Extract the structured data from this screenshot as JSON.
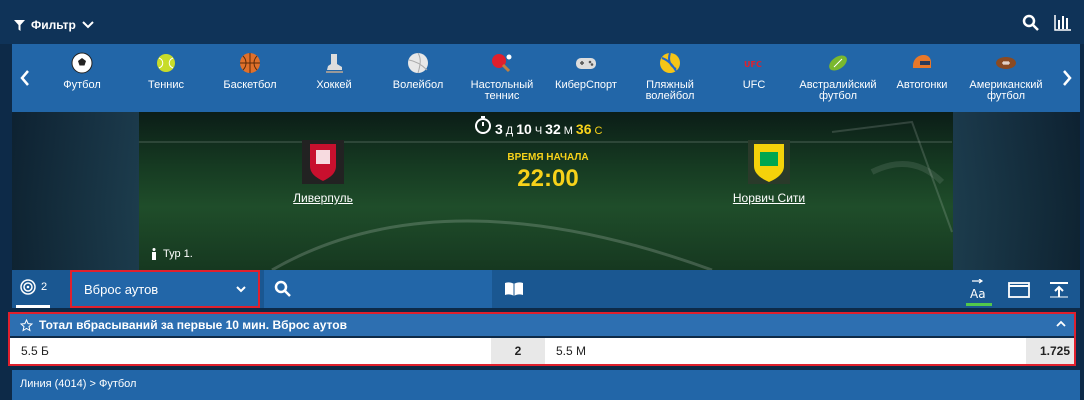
{
  "topbar": {
    "filter_label": "Фильтр"
  },
  "sports": [
    {
      "label": "Футбол",
      "icon": "soccer-ball-icon"
    },
    {
      "label": "Теннис",
      "icon": "tennis-ball-icon"
    },
    {
      "label": "Баскетбол",
      "icon": "basketball-icon"
    },
    {
      "label": "Хоккей",
      "icon": "hockey-skate-icon"
    },
    {
      "label": "Волейбол",
      "icon": "volleyball-icon"
    },
    {
      "label": "Настольный теннис",
      "icon": "ping-pong-icon"
    },
    {
      "label": "КиберСпорт",
      "icon": "gamepad-icon"
    },
    {
      "label": "Пляжный волейбол",
      "icon": "beach-volleyball-icon"
    },
    {
      "label": "UFC",
      "icon": "ufc-logo-icon"
    },
    {
      "label": "Австралийский футбол",
      "icon": "aussie-football-icon"
    },
    {
      "label": "Автогонки",
      "icon": "racing-helmet-icon"
    },
    {
      "label": "Американский футбол",
      "icon": "american-football-icon"
    }
  ],
  "match": {
    "countdown": {
      "days": "3",
      "d_unit": "Д",
      "hours": "10",
      "h_unit": "Ч",
      "minutes": "32",
      "m_unit": "М",
      "seconds": "36",
      "s_unit": "С"
    },
    "home": "Ливерпуль",
    "away": "Норвич Сити",
    "start_label": "ВРЕМЯ НАЧАЛА",
    "start_time": "22:00",
    "tour": "Тур 1."
  },
  "controls": {
    "count": "2",
    "select_value": "Вброс аутов"
  },
  "market": {
    "title": "Тотал вбрасываний за первые 10 мин. Вброс аутов",
    "row": [
      {
        "label": "5.5 Б",
        "odds": "2"
      },
      {
        "label": "5.5 М",
        "odds": "1.725"
      }
    ]
  },
  "breadcrumb": {
    "line": "Линия (4014)",
    "sep": " > ",
    "sport": "Футбол"
  },
  "colors": {
    "accent_yellow": "#f7d21a",
    "highlight_red": "#e0202d",
    "nav_blue": "#2266a8",
    "dark_blue": "#0f3358"
  }
}
